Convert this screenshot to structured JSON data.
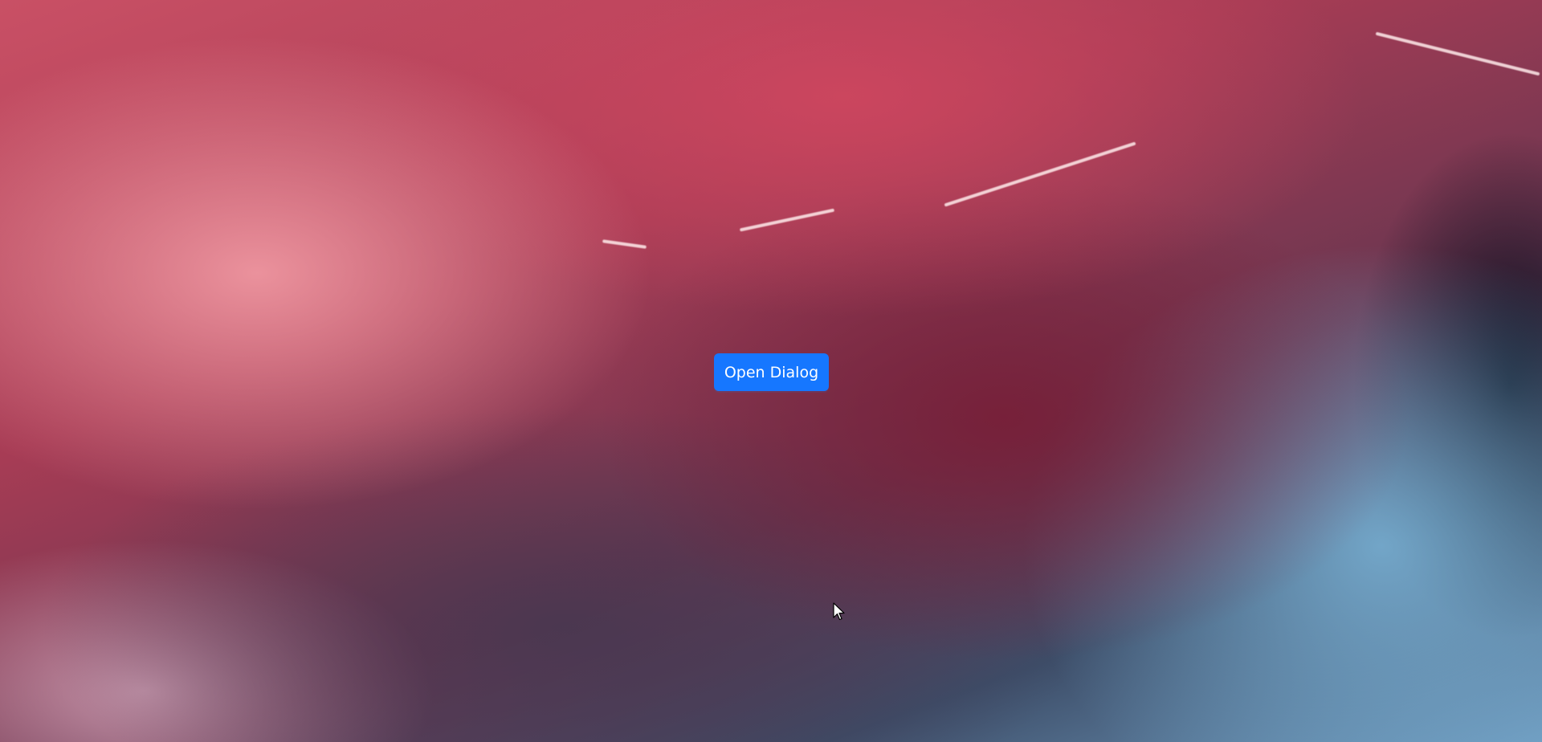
{
  "background": {
    "icon": "abstract-fluid-wallpaper",
    "colors": [
      "#c95065",
      "#a73c55",
      "#6a3650",
      "#3d4d68",
      "#6f9cc0"
    ]
  },
  "main": {
    "open_dialog_label": "Open Dialog"
  },
  "accent_color": "#1677ff"
}
